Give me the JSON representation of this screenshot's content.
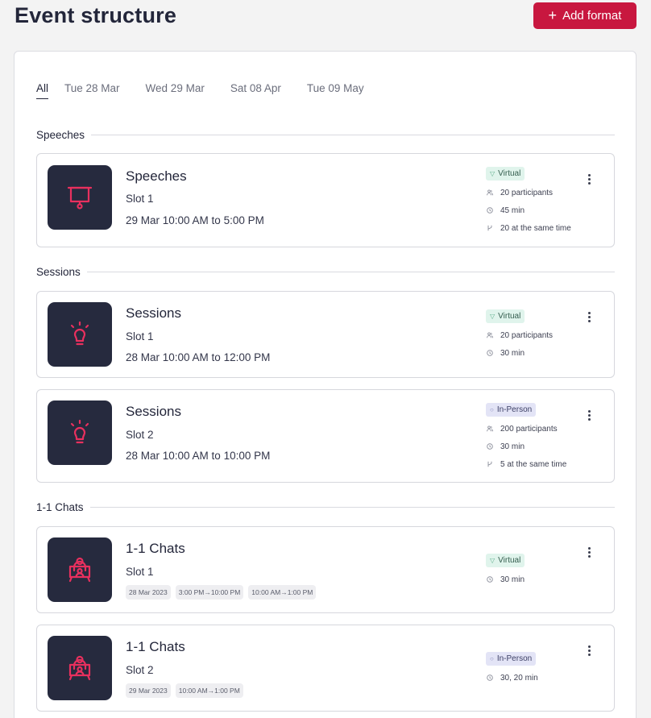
{
  "header": {
    "title": "Event structure",
    "add_format_label": "Add format"
  },
  "tabs": [
    {
      "label": "All",
      "active": true
    },
    {
      "label": "Tue 28 Mar"
    },
    {
      "label": "Wed 29 Mar"
    },
    {
      "label": "Sat 08 Apr"
    },
    {
      "label": "Tue 09 May"
    }
  ],
  "sections": {
    "speeches": "Speeches",
    "sessions": "Sessions",
    "chats": "1-1 Chats"
  },
  "cards": [
    {
      "title": "Speeches",
      "slot": "Slot 1",
      "time": "29 Mar 10:00 AM to 5:00 PM",
      "icon": "presentation-board-icon",
      "badge": "Virtual",
      "participants": "20 participants",
      "duration": "45 min",
      "concurrency": "20 at the same time"
    },
    {
      "title": "Sessions",
      "slot": "Slot 1",
      "time": "28 Mar 10:00 AM to 12:00 PM",
      "icon": "lightbulb-icon",
      "badge": "Virtual",
      "participants": "20 participants",
      "duration": "30 min"
    },
    {
      "title": "Sessions",
      "slot": "Slot 2",
      "time": "28 Mar 10:00 AM to 10:00 PM",
      "icon": "lightbulb-icon",
      "badge": "In-Person",
      "participants": "200 participants",
      "duration": "30 min",
      "concurrency": "5 at the same time"
    },
    {
      "title": "1-1 Chats",
      "slot": "Slot 1",
      "icon": "person-desk-icon",
      "chips": [
        "28 Mar 2023",
        "3:00 PM→10:00 PM",
        "10:00 AM→1:00 PM"
      ],
      "badge": "Virtual",
      "duration": "30 min"
    },
    {
      "title": "1-1 Chats",
      "slot": "Slot 2",
      "icon": "person-desk-icon",
      "chips": [
        "29 Mar 2023",
        "10:00 AM→1:00 PM"
      ],
      "badge": "In-Person",
      "duration": "30, 20 min"
    }
  ],
  "colors": {
    "accent": "#c8173f",
    "tile": "#262a3e",
    "icon": "#e8305e",
    "virtual_bg": "#e0f4ec",
    "inperson_bg": "#e3e4f6"
  }
}
